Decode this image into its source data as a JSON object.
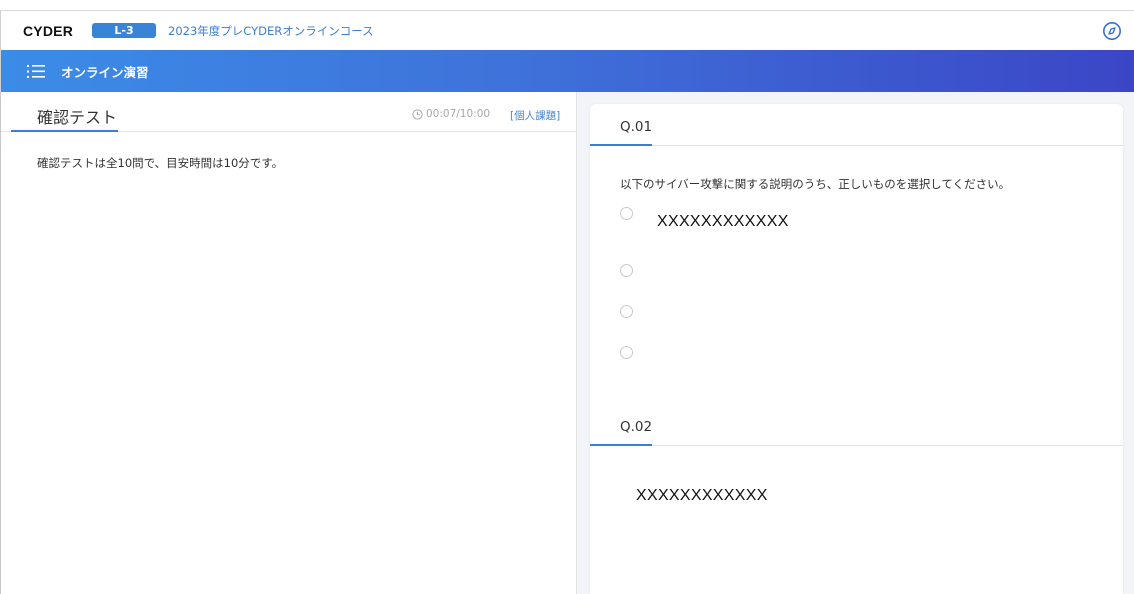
{
  "header": {
    "brand": "CYDER",
    "level": "L-3",
    "course_title": "2023年度プレCYDERオンラインコース",
    "help_icon": "compass-icon"
  },
  "nav": {
    "menu_icon": "list-menu-icon",
    "title": "オンライン演習"
  },
  "test": {
    "title": "確認テスト",
    "timer": "00:07/10:00",
    "task_type": "[個人課題]",
    "intro": "確認テストは全10問で、目安時間は10分です。"
  },
  "questions": [
    {
      "label": "Q.01",
      "text": "以下のサイバー攻撃に関する説明のうち、正しいものを選択してください。",
      "options": [
        "XXXXXXXXXXXX",
        "",
        "",
        ""
      ]
    },
    {
      "label": "Q.02",
      "text": "XXXXXXXXXXXX"
    }
  ],
  "colors": {
    "accent": "#3a7fd5",
    "nav_gradient_start": "#3b8ce7",
    "nav_gradient_end": "#3b46c6",
    "badge": "#3a84d8"
  }
}
